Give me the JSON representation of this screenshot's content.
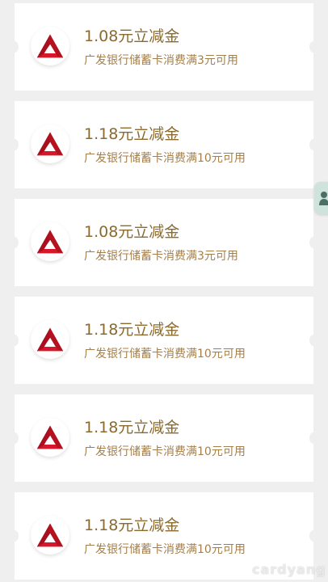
{
  "coupons": [
    {
      "title": "1.08元立减金",
      "desc": "广发银行储蓄卡消费满3元可用"
    },
    {
      "title": "1.18元立减金",
      "desc": "广发银行储蓄卡消费满10元可用"
    },
    {
      "title": "1.08元立减金",
      "desc": "广发银行储蓄卡消费满3元可用"
    },
    {
      "title": "1.18元立减金",
      "desc": "广发银行储蓄卡消费满10元可用"
    },
    {
      "title": "1.18元立减金",
      "desc": "广发银行储蓄卡消费满10元可用"
    },
    {
      "title": "1.18元立减金",
      "desc": "广发银行储蓄卡消费满10元可用"
    }
  ],
  "theme": {
    "background": "#efefef",
    "card": "#ffffff",
    "title_color": "#8a6a2f",
    "desc_color": "#a57f4a",
    "logo_red": "#d7182a"
  },
  "icons": {
    "bank_logo": "cgb-triangle-logo-icon",
    "side_widget": "floating-assistant-icon"
  },
  "watermark": "cardyang"
}
